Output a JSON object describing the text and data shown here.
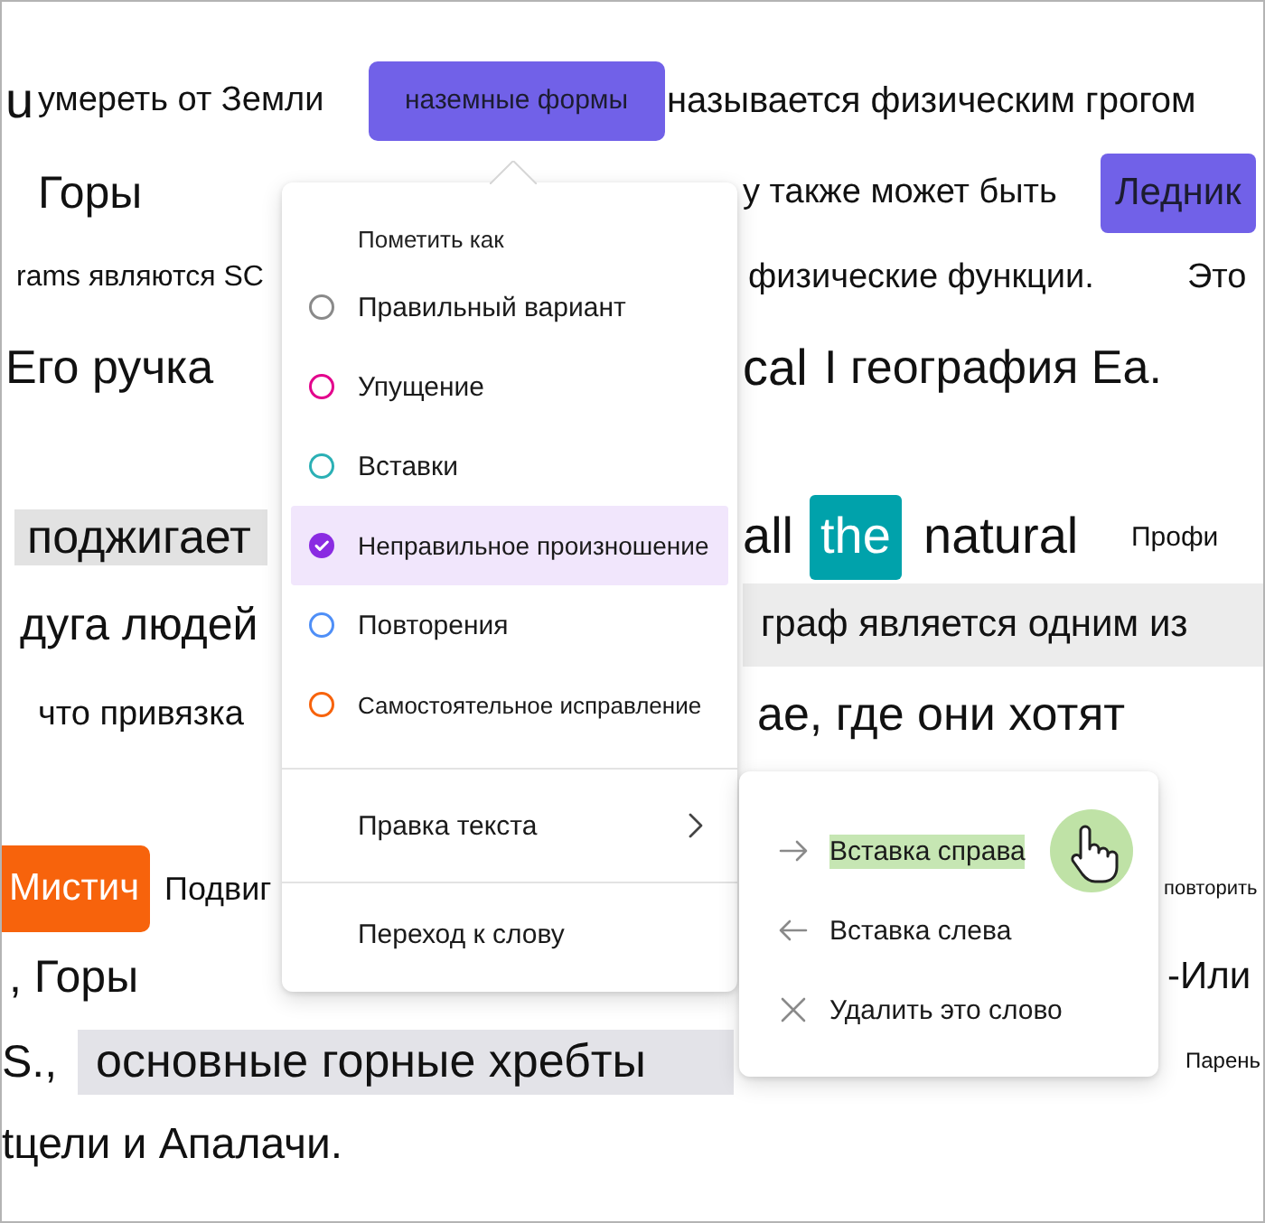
{
  "document": {
    "lines": [
      {
        "fragments": [
          {
            "text": "u",
            "kind": "plain"
          },
          {
            "text": "умереть от Земли",
            "kind": "plain"
          },
          {
            "text": "наземные формы",
            "kind": "selection",
            "color": "#7161e8"
          },
          {
            "text": "называется физическим грогом",
            "kind": "plain"
          }
        ]
      },
      {
        "fragments": [
          {
            "text": "Горы",
            "kind": "plain"
          },
          {
            "text": "у также может быть",
            "kind": "plain"
          },
          {
            "text": "Ледник",
            "kind": "selection",
            "color": "#7161e8"
          }
        ]
      },
      {
        "fragments": [
          {
            "text": "rams являются SC",
            "kind": "plain"
          },
          {
            "text": "физические функции.",
            "kind": "plain"
          },
          {
            "text": "Это",
            "kind": "plain"
          }
        ]
      },
      {
        "fragments": [
          {
            "text": "Его ручка",
            "kind": "plain"
          },
          {
            "text": "cal",
            "kind": "plain"
          },
          {
            "text": "I география Ea.",
            "kind": "plain"
          }
        ]
      },
      {
        "fragments": [
          {
            "text": "поджигает",
            "kind": "shaded"
          },
          {
            "text": "all",
            "kind": "plain"
          },
          {
            "text": "the",
            "kind": "chip",
            "color": "#00a2ab"
          },
          {
            "text": "natural",
            "kind": "plain"
          },
          {
            "text": "Профи",
            "kind": "plain"
          }
        ]
      },
      {
        "fragments": [
          {
            "text": "дуга людей",
            "kind": "plain"
          },
          {
            "text": "граф является одним из",
            "kind": "shaded"
          }
        ]
      },
      {
        "fragments": [
          {
            "text": "что привязка",
            "kind": "plain"
          },
          {
            "text": "ае, где они хотят",
            "kind": "plain"
          }
        ]
      },
      {
        "fragments": [
          {
            "text": "Мистич",
            "kind": "chip",
            "color": "#f7630c"
          },
          {
            "text": "Подвиг",
            "kind": "plain"
          },
          {
            "text": "повторить",
            "kind": "tag"
          }
        ]
      },
      {
        "fragments": [
          {
            "text": ", Горы",
            "kind": "plain"
          },
          {
            "text": "-Или",
            "kind": "plain"
          }
        ]
      },
      {
        "fragments": [
          {
            "text": "S.,",
            "kind": "plain"
          },
          {
            "text": "основные горные хребты",
            "kind": "shaded"
          },
          {
            "text": "Парень",
            "kind": "plain"
          }
        ]
      },
      {
        "fragments": [
          {
            "text": "tцели и Апалачи.",
            "kind": "plain"
          }
        ]
      }
    ]
  },
  "mark_menu": {
    "heading": "Пометить как",
    "options": [
      {
        "label": "Правильный вариант",
        "color": "#8a8a8a",
        "selected": false
      },
      {
        "label": "Упущение",
        "color": "#e3008c",
        "selected": false
      },
      {
        "label": "Вставки",
        "color": "#2bb0b5",
        "selected": false
      },
      {
        "label": "Неправильное произношение",
        "color": "#8a2be2",
        "selected": true
      },
      {
        "label": "Повторения",
        "color": "#4f8ff7",
        "selected": false
      },
      {
        "label": "Самостоятельное исправление",
        "color": "#f7630c",
        "selected": false
      }
    ],
    "actions": [
      {
        "label": "Правка текста",
        "kind": "submenu"
      },
      {
        "label": "Переход к слову",
        "kind": "plain"
      }
    ]
  },
  "edit_submenu": {
    "items": [
      {
        "label": "Вставка справа",
        "kind": "insert-right",
        "selected": true
      },
      {
        "label": "Вставка слева",
        "kind": "insert-left",
        "selected": false
      },
      {
        "label": "Удалить это слово",
        "kind": "delete",
        "selected": false
      }
    ]
  }
}
